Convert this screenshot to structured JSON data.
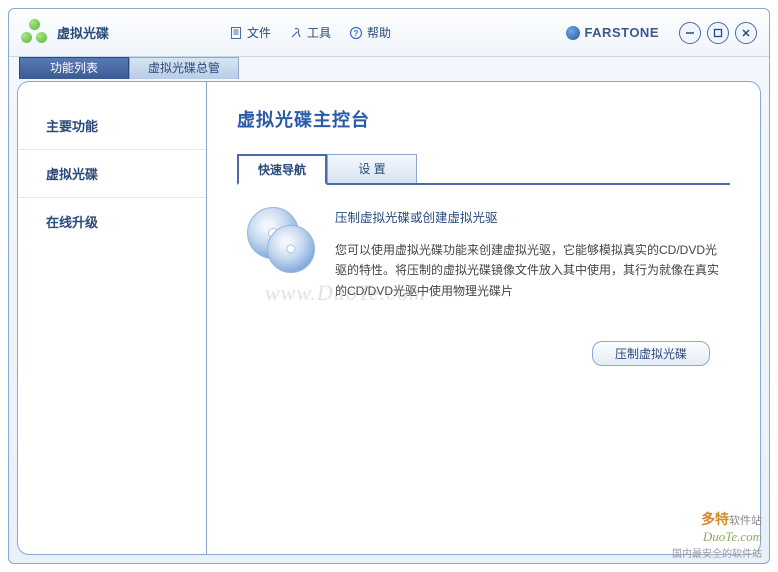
{
  "app": {
    "title": "虚拟光碟"
  },
  "menu": {
    "file": "文件",
    "tools": "工具",
    "help": "帮助"
  },
  "brand": "FARSTONE",
  "top_tabs": {
    "active": "功能列表",
    "inactive": "虚拟光碟总管"
  },
  "sidebar": {
    "items": [
      "主要功能",
      "虚拟光碟",
      "在线升级"
    ]
  },
  "main": {
    "title": "虚拟光碟主控台",
    "tabs": {
      "quick": "快速导航",
      "settings": "设  置"
    },
    "section_title": "压制虚拟光碟或创建虚拟光驱",
    "section_body": "您可以使用虚拟光碟功能来创建虚拟光驱，它能够模拟真实的CD/DVD光驱的特性。将压制的虚拟光碟镜像文件放入其中使用，其行为就像在真实的CD/DVD光驱中使用物理光碟片",
    "action": "压制虚拟光碟"
  },
  "watermark": {
    "center": "www.DuoTe.com",
    "logo_main": "多特",
    "logo_suffix": "软件站",
    "domain": "DuoTe.com",
    "tagline": "国内最安全的软件站"
  }
}
